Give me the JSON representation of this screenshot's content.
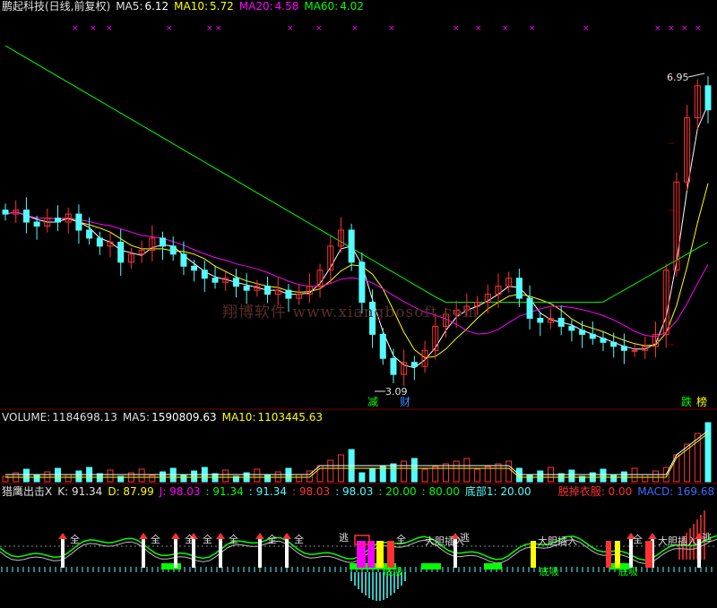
{
  "main_header": {
    "title": "鹏起科技(日线,前复权)",
    "ma5_label": "MA5:",
    "ma5_value": "6.12",
    "ma10_label": "MA10:",
    "ma10_value": "5.72",
    "ma20_label": "MA20:",
    "ma20_value": "4.58",
    "ma60_label": "MA60:",
    "ma60_value": "4.02"
  },
  "volume_header": {
    "label": "VOLUME:",
    "value": "1184698.13",
    "ma5_label": "MA5:",
    "ma5_value": "1590809.63",
    "ma10_label": "MA10:",
    "ma10_value": "1103445.63"
  },
  "indicator_header": {
    "name": "猎鹰出击X",
    "k": "K: 91.34",
    "d": "D: 87.99",
    "j": "J: 98.03",
    "v1": ": 91.34",
    "v2": ": 91.34",
    "v3": ": 98.03",
    "v4": ": 98.03",
    "v5": ": 20.00",
    "v6": ": 80.00",
    "bottom": "底部1: 20.00",
    "escape": "脱掉衣服: 0.00",
    "macd": "MACD: 169.68"
  },
  "annotations": {
    "high_price": "6.95",
    "low_price": "3.09",
    "watermark": "翔博软件  www.xiangbosoft.com",
    "reduce": "减",
    "wealth": "财",
    "fall": "跌",
    "rank": "榜"
  },
  "indicator_labels": {
    "full": "全",
    "escape": "逃",
    "bold_insert": "大胆插入",
    "bottom_suck": "底吸",
    "bold_insert_2": "大胆插入"
  },
  "colors": {
    "up": "#ff3232",
    "down": "#54fcfc",
    "ma5": "#ffffff",
    "ma10": "#ffff00",
    "ma20": "#ff00ff",
    "ma60": "#00ff00",
    "grid": "#7a0000"
  },
  "chart_data": [
    {
      "type": "candlestick",
      "title": "鹏起科技(日线,前复权)",
      "series": [
        {
          "name": "MA5",
          "values": [
            6.12
          ]
        },
        {
          "name": "MA10",
          "values": [
            5.72
          ]
        },
        {
          "name": "MA20",
          "values": [
            4.58
          ]
        },
        {
          "name": "MA60",
          "values": [
            4.02
          ]
        }
      ],
      "annotations": [
        {
          "label": "6.95",
          "kind": "high"
        },
        {
          "label": "3.09",
          "kind": "low"
        }
      ],
      "close_approx": [
        5.2,
        5.25,
        5.1,
        5.05,
        5.15,
        5.1,
        5.2,
        5.0,
        4.9,
        4.8,
        4.85,
        4.6,
        4.7,
        4.75,
        4.9,
        4.8,
        4.7,
        4.55,
        4.5,
        4.4,
        4.35,
        4.4,
        4.3,
        4.25,
        4.3,
        4.2,
        4.25,
        4.15,
        4.2,
        4.3,
        4.5,
        4.8,
        5.0,
        4.6,
        4.1,
        3.7,
        3.4,
        3.2,
        3.35,
        3.3,
        3.5,
        3.8,
        3.95,
        4.0,
        4.05,
        4.1,
        4.2,
        4.3,
        4.4,
        4.15,
        3.9,
        3.85,
        3.9,
        3.8,
        3.75,
        3.7,
        3.65,
        3.6,
        3.55,
        3.5,
        3.5,
        3.55,
        3.7,
        4.5,
        5.6,
        6.4,
        6.8,
        6.5
      ]
    },
    {
      "type": "bar",
      "title": "VOLUME",
      "series": [
        {
          "name": "VOLUME",
          "values": [
            1184698.13
          ]
        },
        {
          "name": "MA5",
          "values": [
            1590809.63
          ]
        },
        {
          "name": "MA10",
          "values": [
            1103445.63
          ]
        }
      ]
    },
    {
      "type": "line",
      "title": "猎鹰出击X",
      "series": [
        {
          "name": "K",
          "values": [
            91.34
          ]
        },
        {
          "name": "D",
          "values": [
            87.99
          ]
        },
        {
          "name": "J",
          "values": [
            98.03
          ]
        },
        {
          "name": "底部1",
          "values": [
            20.0
          ]
        },
        {
          "name": "脱掉衣服",
          "values": [
            0.0
          ]
        },
        {
          "name": "MACD",
          "values": [
            169.68
          ]
        }
      ]
    }
  ]
}
